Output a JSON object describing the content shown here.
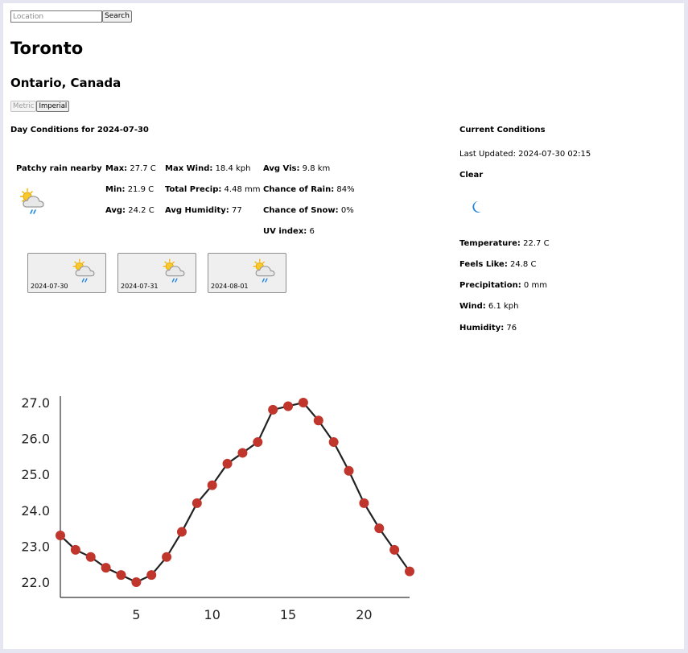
{
  "search": {
    "placeholder": "Location",
    "button_label": "Search"
  },
  "location": {
    "city": "Toronto",
    "region": "Ontario, Canada"
  },
  "units": {
    "metric_label": "Metric",
    "imperial_label": "Imperial",
    "active": "Metric"
  },
  "day": {
    "title": "Day Conditions for 2024-07-30",
    "summary": "Patchy rain nearby",
    "icon": "patchy-rain-icon",
    "stats": [
      {
        "label": "Max:",
        "value": "27.7 C"
      },
      {
        "label": "Min:",
        "value": "21.9 C"
      },
      {
        "label": "Avg:",
        "value": "24.2 C"
      },
      {
        "label": "Max Wind:",
        "value": "18.4 kph"
      },
      {
        "label": "Total Precip:",
        "value": "4.48 mm"
      },
      {
        "label": "Avg Humidity:",
        "value": "77"
      },
      {
        "label": "Avg Vis:",
        "value": "9.8 km"
      },
      {
        "label": "Chance of Rain:",
        "value": "84%"
      },
      {
        "label": "Chance of Snow:",
        "value": "0%"
      },
      {
        "label": "UV index:",
        "value": "6"
      }
    ]
  },
  "forecast": [
    {
      "date": "2024-07-30",
      "icon": "patchy-rain-icon"
    },
    {
      "date": "2024-07-31",
      "icon": "patchy-rain-icon"
    },
    {
      "date": "2024-08-01",
      "icon": "patchy-rain-icon"
    }
  ],
  "current": {
    "title": "Current Conditions",
    "last_updated": "Last Updated: 2024-07-30 02:15",
    "condition": "Clear",
    "icon": "moon-icon",
    "stats": [
      {
        "label": "Temperature:",
        "value": "22.7 C"
      },
      {
        "label": "Feels Like:",
        "value": "24.8 C"
      },
      {
        "label": "Precipitation:",
        "value": "0 mm"
      },
      {
        "label": "Wind:",
        "value": "6.1 kph"
      },
      {
        "label": "Humidity:",
        "value": "76"
      }
    ]
  },
  "chart_data": {
    "type": "line",
    "x": [
      0,
      1,
      2,
      3,
      4,
      5,
      6,
      7,
      8,
      9,
      10,
      11,
      12,
      13,
      14,
      15,
      16,
      17,
      18,
      19,
      20,
      21,
      22,
      23
    ],
    "values": [
      23.3,
      22.9,
      22.7,
      22.4,
      22.2,
      22.0,
      22.2,
      22.7,
      23.4,
      24.2,
      24.7,
      25.3,
      25.6,
      25.9,
      26.8,
      26.9,
      27.0,
      26.5,
      25.9,
      25.1,
      24.2,
      23.5,
      22.9,
      22.3
    ],
    "xticks": [
      "5",
      "10",
      "15",
      "20"
    ],
    "yticks": [
      "22.0",
      "23.0",
      "24.0",
      "25.0",
      "26.0",
      "27.0"
    ],
    "ylim": [
      22.0,
      27.0
    ],
    "line_color": "#222222",
    "marker_color": "#c0362c",
    "grid": false
  }
}
